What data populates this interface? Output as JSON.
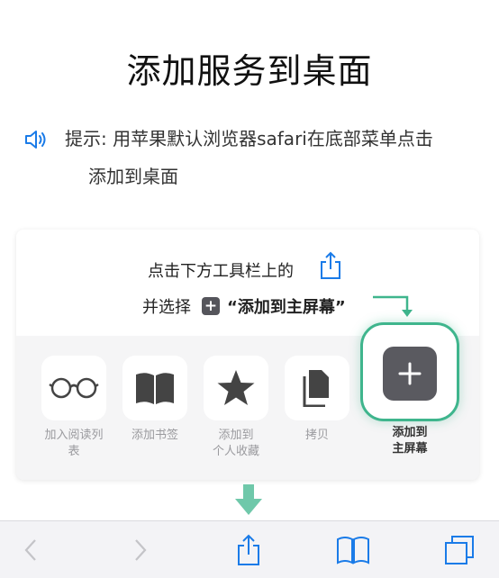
{
  "title": "添加服务到桌面",
  "tip": {
    "icon": "speaker-icon",
    "line1": "提示: 用苹果默认浏览器safari在底部菜单点击",
    "line2": "添加到桌面"
  },
  "card": {
    "instruction_line1": "点击下方工具栏上的",
    "instruction_line2_prefix": "并选择",
    "instruction_line2_highlight": "“添加到主屏幕”",
    "actions": [
      {
        "icon": "glasses-icon",
        "label": "加入阅读列表"
      },
      {
        "icon": "book-icon",
        "label": "添加书签"
      },
      {
        "icon": "star-icon",
        "label_line1": "添加到",
        "label_line2": "个人收藏"
      },
      {
        "icon": "copy-icon",
        "label": "拷贝"
      }
    ],
    "add_to_home": {
      "icon": "plus-icon",
      "label_line1": "添加到",
      "label_line2": "主屏幕"
    }
  },
  "toolbar": {
    "items": [
      "back-icon",
      "forward-icon",
      "share-icon",
      "bookmarks-icon",
      "tabs-icon"
    ]
  },
  "colors": {
    "accent_green": "#3fb58d",
    "ios_blue": "#1a7be8",
    "tile_dark": "#5a5a60"
  }
}
